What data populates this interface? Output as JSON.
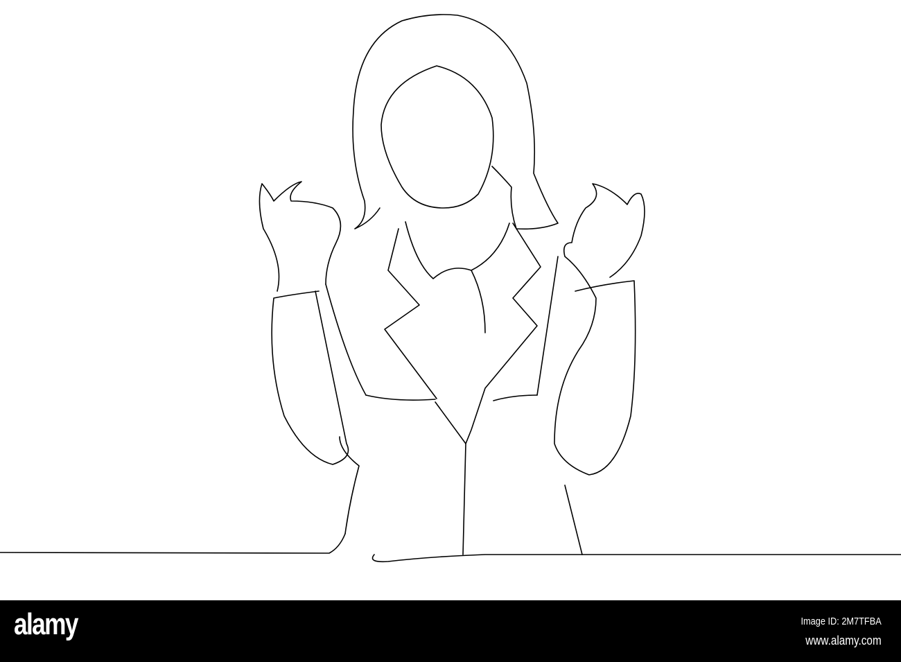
{
  "watermark": {
    "logo": "alamy",
    "image_id": "Image ID: 2M7TFBA",
    "url": "www.alamy.com"
  }
}
